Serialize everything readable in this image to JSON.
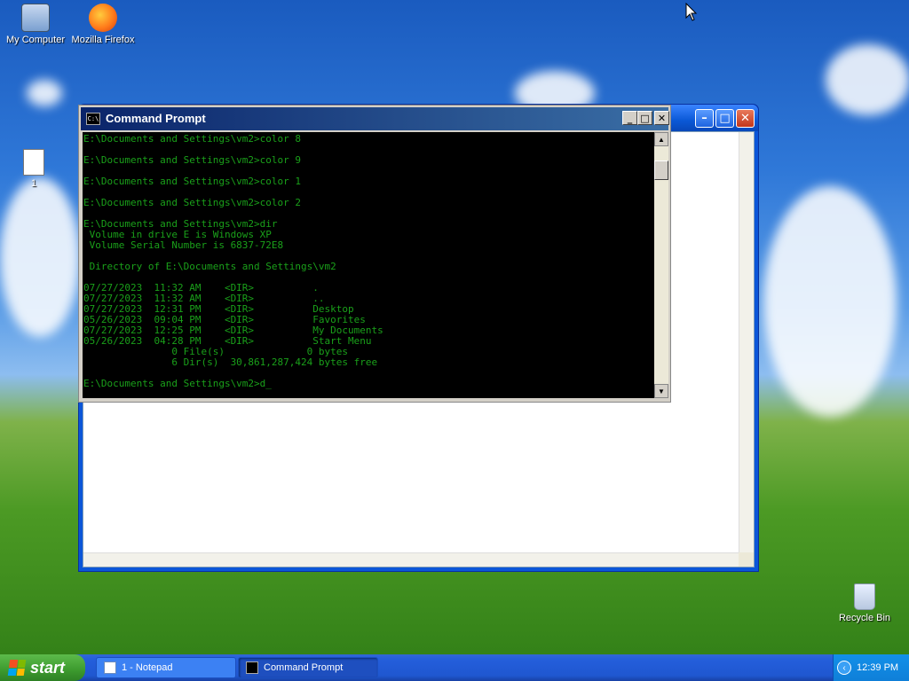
{
  "desktop": {
    "icons": [
      {
        "label": "My Computer"
      },
      {
        "label": "Mozilla Firefox"
      },
      {
        "label": "1"
      },
      {
        "label": "Recycle Bin"
      }
    ]
  },
  "notepad": {
    "title": ""
  },
  "cmd": {
    "title": "Command Prompt",
    "lines": [
      "E:\\Documents and Settings\\vm2>color 8",
      "",
      "E:\\Documents and Settings\\vm2>color 9",
      "",
      "E:\\Documents and Settings\\vm2>color 1",
      "",
      "E:\\Documents and Settings\\vm2>color 2",
      "",
      "E:\\Documents and Settings\\vm2>dir",
      " Volume in drive E is Windows XP",
      " Volume Serial Number is 6837-72E8",
      "",
      " Directory of E:\\Documents and Settings\\vm2",
      "",
      "07/27/2023  11:32 AM    <DIR>          .",
      "07/27/2023  11:32 AM    <DIR>          ..",
      "07/27/2023  12:31 PM    <DIR>          Desktop",
      "05/26/2023  09:04 PM    <DIR>          Favorites",
      "07/27/2023  12:25 PM    <DIR>          My Documents",
      "05/26/2023  04:28 PM    <DIR>          Start Menu",
      "               0 File(s)              0 bytes",
      "               6 Dir(s)  30,861,287,424 bytes free",
      "",
      "E:\\Documents and Settings\\vm2>d_"
    ]
  },
  "taskbar": {
    "start_label": "start",
    "tasks": [
      {
        "label": "1 - Notepad"
      },
      {
        "label": "Command Prompt"
      }
    ],
    "clock": "12:39 PM"
  }
}
